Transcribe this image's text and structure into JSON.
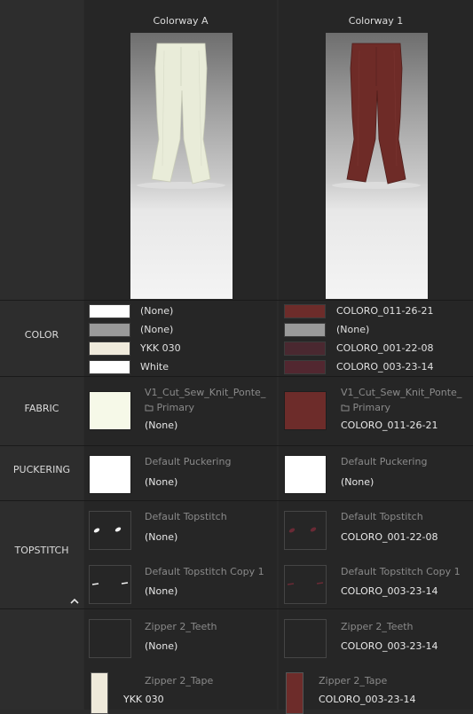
{
  "columns": {
    "a": {
      "title": "Colorway A",
      "garment_color": "#e9ecd9",
      "color_rows": [
        {
          "swatch": "#ffffff",
          "label": "(None)"
        },
        {
          "swatch": "#9a9a9a",
          "label": "(None)"
        },
        {
          "swatch": "#efeadb",
          "label": "YKK 030"
        },
        {
          "swatch": "#ffffff",
          "label": "White"
        }
      ],
      "fabric": {
        "swatch": "#f6f9e8",
        "name": "V1_Cut_Sew_Knit_Ponte_",
        "tag": "Primary",
        "value": "(None)"
      },
      "puckering": {
        "swatch": "#ffffff",
        "name": "Default Puckering",
        "value": "(None)"
      },
      "topstitch": [
        {
          "name": "Default Topstitch",
          "value": "(None)",
          "stitch_color": "#f2f2f2"
        },
        {
          "name": "Default Topstitch Copy 1",
          "value": "(None)",
          "stitch_color": "#f2f2f2"
        }
      ],
      "zipper_teeth": {
        "name": "Zipper 2_Teeth",
        "value": "(None)"
      },
      "zipper_tape": {
        "name": "Zipper 2_Tape",
        "value": "YKK 030",
        "swatch": "#efeadb"
      }
    },
    "b": {
      "title": "Colorway 1",
      "garment_color": "#6e2b27",
      "color_rows": [
        {
          "swatch": "#6d2c2a",
          "label": "COLORO_011-26-21"
        },
        {
          "swatch": "#9a9a9a",
          "label": "(None)"
        },
        {
          "swatch": "#4a2830",
          "label": "COLORO_001-22-08"
        },
        {
          "swatch": "#522730",
          "label": "COLORO_003-23-14"
        }
      ],
      "fabric": {
        "swatch": "#6d2c2a",
        "name": "V1_Cut_Sew_Knit_Ponte_",
        "tag": "Primary",
        "value": "COLORO_011-26-21"
      },
      "puckering": {
        "swatch": "#ffffff",
        "name": "Default Puckering",
        "value": "(None)"
      },
      "topstitch": [
        {
          "name": "Default Topstitch",
          "value": "COLORO_001-22-08",
          "stitch_color": "#5a2630"
        },
        {
          "name": "Default Topstitch Copy 1",
          "value": "COLORO_003-23-14",
          "stitch_color": "#5a2630"
        }
      ],
      "zipper_teeth": {
        "name": "Zipper 2_Teeth",
        "value": "COLORO_003-23-14"
      },
      "zipper_tape": {
        "name": "Zipper 2_Tape",
        "value": "COLORO_003-23-14",
        "swatch": "#6d2c2a"
      }
    }
  },
  "sections": {
    "color": "COLOR",
    "fabric": "FABRIC",
    "puckering": "PUCKERING",
    "topstitch": "TOPSTITCH"
  },
  "icons": {
    "primary": "folder-icon",
    "collapse": "chevron-up-icon"
  }
}
